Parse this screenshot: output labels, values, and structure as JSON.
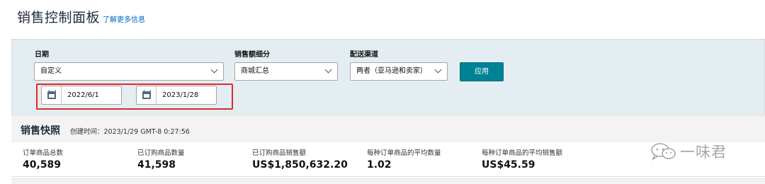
{
  "header": {
    "title": "销售控制面板",
    "learn_more": "了解更多信息"
  },
  "filters": {
    "date": {
      "label": "日期",
      "value": "自定义",
      "start": "2022/6/1",
      "end": "2023/1/28"
    },
    "breakdown": {
      "label": "销售额细分",
      "value": "商城汇总"
    },
    "channel": {
      "label": "配送渠道",
      "value": "两者（亚马逊和卖家）"
    },
    "apply_label": "应用"
  },
  "snapshot": {
    "title": "销售快照",
    "created": "创建时间：2023/1/29 GMT-8 0:27:56",
    "metrics": [
      {
        "label": "订单商品总数",
        "value": "40,589"
      },
      {
        "label": "已订购商品数量",
        "value": "41,598"
      },
      {
        "label": "已订购商品销售额",
        "value": "US$1,850,632.20"
      },
      {
        "label": "每种订单商品的平均数量",
        "value": "1.02"
      },
      {
        "label": "每种订单商品的平均销售额",
        "value": "US$45.59"
      }
    ]
  },
  "watermark": {
    "text": "一味君",
    "icon": "wechat-icon"
  },
  "colors": {
    "accent": "#008296",
    "panel_bg": "#e4eef2",
    "highlight": "#e0282e"
  }
}
